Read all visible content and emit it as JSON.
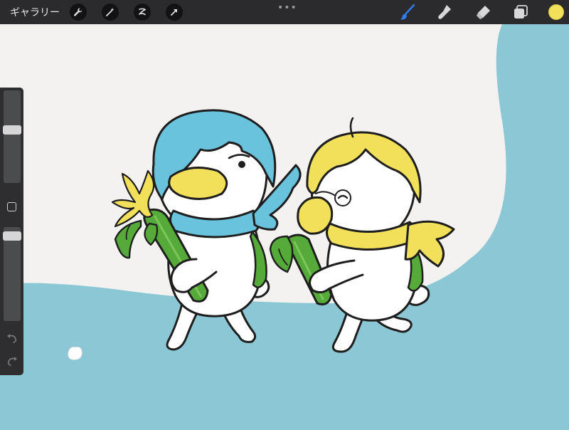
{
  "toolbar": {
    "gallery_label": "ギャラリー",
    "left_tools": [
      "wrench-icon",
      "magic-wand-icon",
      "selection-icon",
      "transform-arrow-icon"
    ],
    "more_label": "•••",
    "right_tools": [
      "brush-icon",
      "smudge-icon",
      "eraser-icon",
      "layers-icon"
    ],
    "active_tool": "brush-icon",
    "accent_color": "#2f7cf6",
    "current_color": "#f2df5a"
  },
  "sidebar": {
    "brush_size_level": 0.58,
    "opacity_level": 0.95,
    "icons": [
      "undo-icon",
      "redo-icon"
    ]
  },
  "canvas": {
    "background_color": "#8cc7d6",
    "panel_color": "#f4f2f1",
    "hair_blue": "#69c3dc",
    "hair_yellow": "#f2df5a",
    "leaf_green": "#55aa3a"
  }
}
